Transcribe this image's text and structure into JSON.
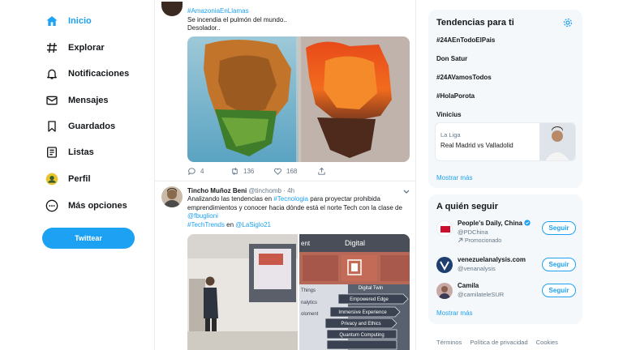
{
  "nav": {
    "items": [
      {
        "label": "Inicio",
        "icon": "home-icon",
        "active": true
      },
      {
        "label": "Explorar",
        "icon": "hashtag-icon"
      },
      {
        "label": "Notificaciones",
        "icon": "bell-icon"
      },
      {
        "label": "Mensajes",
        "icon": "envelope-icon"
      },
      {
        "label": "Guardados",
        "icon": "bookmark-icon"
      },
      {
        "label": "Listas",
        "icon": "list-icon"
      },
      {
        "label": "Perfil",
        "icon": "avatar-icon"
      },
      {
        "label": "Más opciones",
        "icon": "more-icon"
      }
    ],
    "tweet_button": "Twittear"
  },
  "feed": {
    "tweet1": {
      "hashtag": "#AmazoniaEnLlamas",
      "line1": "Se incendia el pulmón del mundo..",
      "line2": "Desolador..",
      "replies": "4",
      "retweets": "136",
      "likes": "168"
    },
    "tweet2": {
      "name": "Tincho Muñoz Beni",
      "handle": "@tinchomb · 4h",
      "text_a": "Analizando las tendencias en ",
      "text_link": "#Tecnologia",
      "text_b": " para proyectar prohibida",
      "line2": "emprendimientos y conocer hacia dónde está el norte Tech con la clase de",
      "mention1": "@fbuglioni",
      "hashtag2": "#TechTrends",
      "en": " en ",
      "mention2": "@LaSiglo21",
      "slide": {
        "header_left": "ent",
        "header_right": "Digital",
        "rows_left": [
          "Things",
          "nalytics",
          "oloment"
        ],
        "rows_right": [
          "Digital Twin",
          "Empowered Edge",
          "Immersive Experience",
          "Privacy and Ethics",
          "Quantum Computing"
        ]
      }
    }
  },
  "trends": {
    "title": "Tendencias para ti",
    "items": [
      "#24AEnTodoElPais",
      "Don Satur",
      "#24AVamosTodos",
      "#HolaPorota",
      "Vinicius"
    ],
    "news": {
      "category": "La Liga",
      "title": "Real Madrid vs Valladolid"
    },
    "more": "Mostrar más"
  },
  "who_to_follow": {
    "title": "A quién seguir",
    "accounts": [
      {
        "name": "People's Daily, China",
        "handle": "@PDChina",
        "promo": "Promocionado"
      },
      {
        "name": "venezuelanalysis.com",
        "handle": "@venanalysis"
      },
      {
        "name": "Camila",
        "handle": "@camilateleSUR"
      }
    ],
    "follow_label": "Seguir",
    "more": "Mostrar más"
  },
  "footer": {
    "links": [
      "Términos",
      "Política de privacidad",
      "Cookies"
    ]
  },
  "colors": {
    "accent": "#1da1f2",
    "text": "#14171a",
    "muted": "#657786",
    "panel": "#f5f8fa"
  }
}
